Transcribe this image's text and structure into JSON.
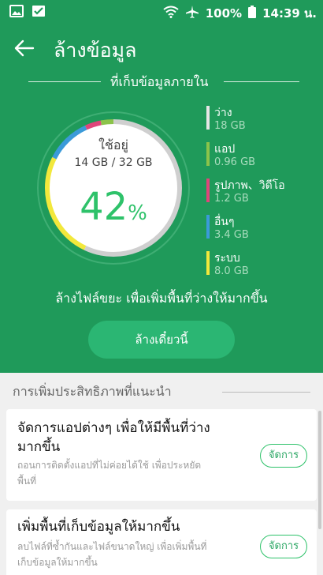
{
  "status_bar": {
    "battery": "100%",
    "time": "14:39 น."
  },
  "header": {
    "title": "ล้างข้อมูล"
  },
  "storage": {
    "section_title": "ที่เก็บข้อมูลภายใน",
    "used_label": "ใช้อยู่",
    "used_value": "14 GB / 32 GB",
    "percent": "42",
    "percent_sign": "%",
    "legend": [
      {
        "label": "ว่าง",
        "value": "18 GB",
        "color": "#e6e6e6"
      },
      {
        "label": "แอป",
        "value": "0.96 GB",
        "color": "#8bc34a"
      },
      {
        "label": "รูปภาพ、วิดีโอ",
        "value": "1.2 GB",
        "color": "#e0457b"
      },
      {
        "label": "อื่นๆ",
        "value": "3.4 GB",
        "color": "#3b9ad9"
      },
      {
        "label": "ระบบ",
        "value": "8.0 GB",
        "color": "#f2e83c"
      }
    ]
  },
  "info_text": "ล้างไฟล์ขยะ เพื่อเพิ่มพื้นที่ว่างให้มากขึ้น",
  "clean_button": "ล้างเดี๋ยวนี้",
  "recommendations": {
    "header": "การเพิ่มประสิทธิภาพที่แนะนำ",
    "cards": [
      {
        "title_line1": "จัดการแอปต่างๆ เพื่อให้มีพื้นที่ว่าง",
        "title_line2": "มากขึ้น",
        "desc_line1": "ถอนการติดตั้งแอปที่ไม่ค่อยได้ใช้ เพื่อประหยัด",
        "desc_line2": "พื้นที่",
        "button": "จัดการ"
      },
      {
        "title_line1": "เพิ่มพื้นที่เก็บข้อมูลให้มากขึ้น",
        "desc_line1": "ลบไฟล์ที่ซ้ำกันและไฟล์ขนาดใหญ่ เพื่อเพิ่มพื้นที่",
        "desc_line2": "เก็บข้อมูลให้มากขึ้น",
        "button": "จัดการ"
      }
    ]
  }
}
